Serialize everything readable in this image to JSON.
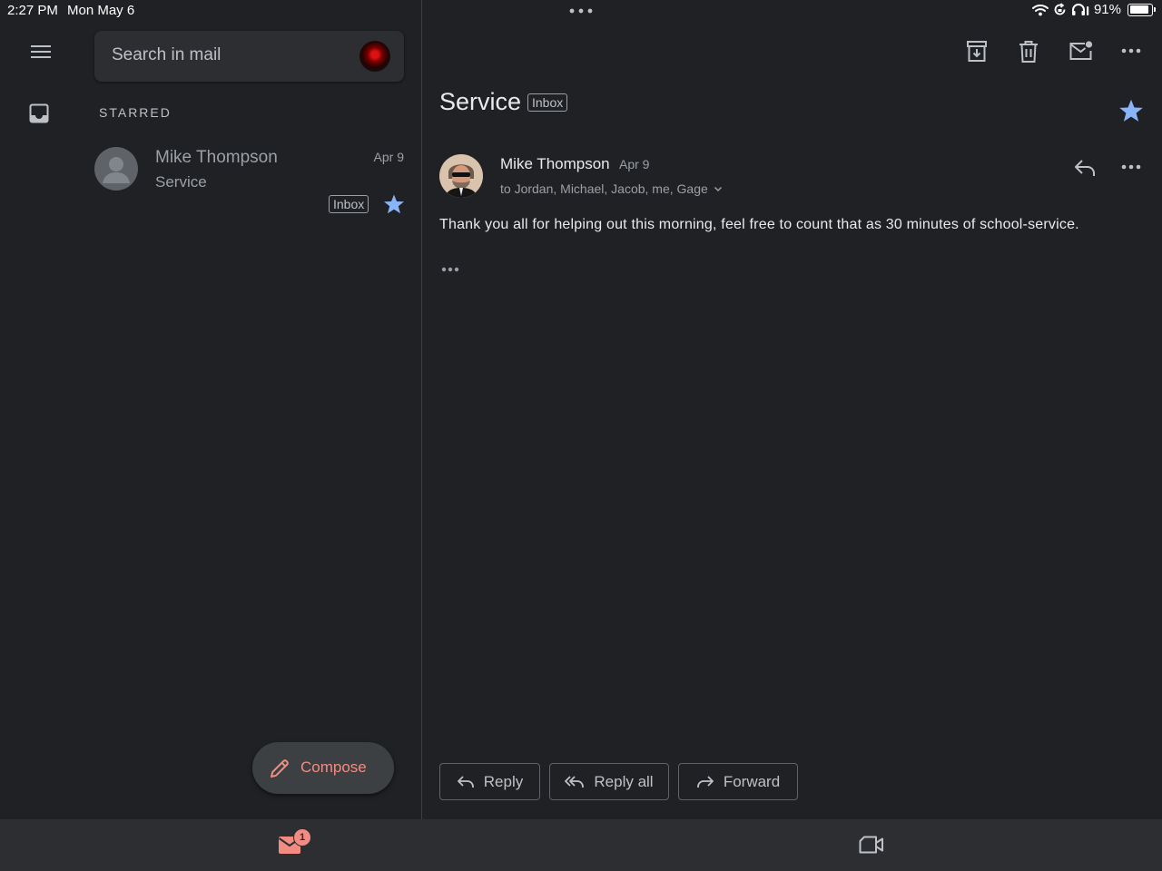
{
  "status_bar": {
    "time": "2:27 PM",
    "date": "Mon May 6",
    "battery": "91%",
    "battery_level": 0.91
  },
  "sidebar": {
    "search_placeholder": "Search in mail",
    "section_label": "STARRED"
  },
  "email_list": {
    "items": [
      {
        "sender": "Mike Thompson",
        "date": "Apr 9",
        "subject": "Service",
        "label": "Inbox",
        "starred": true
      }
    ]
  },
  "compose": {
    "label": "Compose"
  },
  "message": {
    "subject": "Service",
    "label": "Inbox",
    "sender": "Mike Thompson",
    "date": "Apr 9",
    "recipients": "to Jordan, Michael, Jacob, me, Gage",
    "body": "Thank you all for helping out this morning, feel free to count that as 30 minutes of school-service."
  },
  "actions": {
    "reply": "Reply",
    "reply_all": "Reply all",
    "forward": "Forward"
  },
  "bottom_nav": {
    "mail_badge": "1"
  },
  "colors": {
    "background": "#202124",
    "surface": "#2d2e31",
    "accent_red": "#f28b82",
    "star_blue": "#8ab4f8",
    "text_primary": "#e8eaed",
    "text_secondary": "#9aa0a6"
  },
  "icons": {
    "toolbar": [
      "archive-icon",
      "trash-icon",
      "mark-unread-icon",
      "more-icon"
    ],
    "bottom_nav": [
      "mail-icon",
      "video-call-icon"
    ]
  }
}
